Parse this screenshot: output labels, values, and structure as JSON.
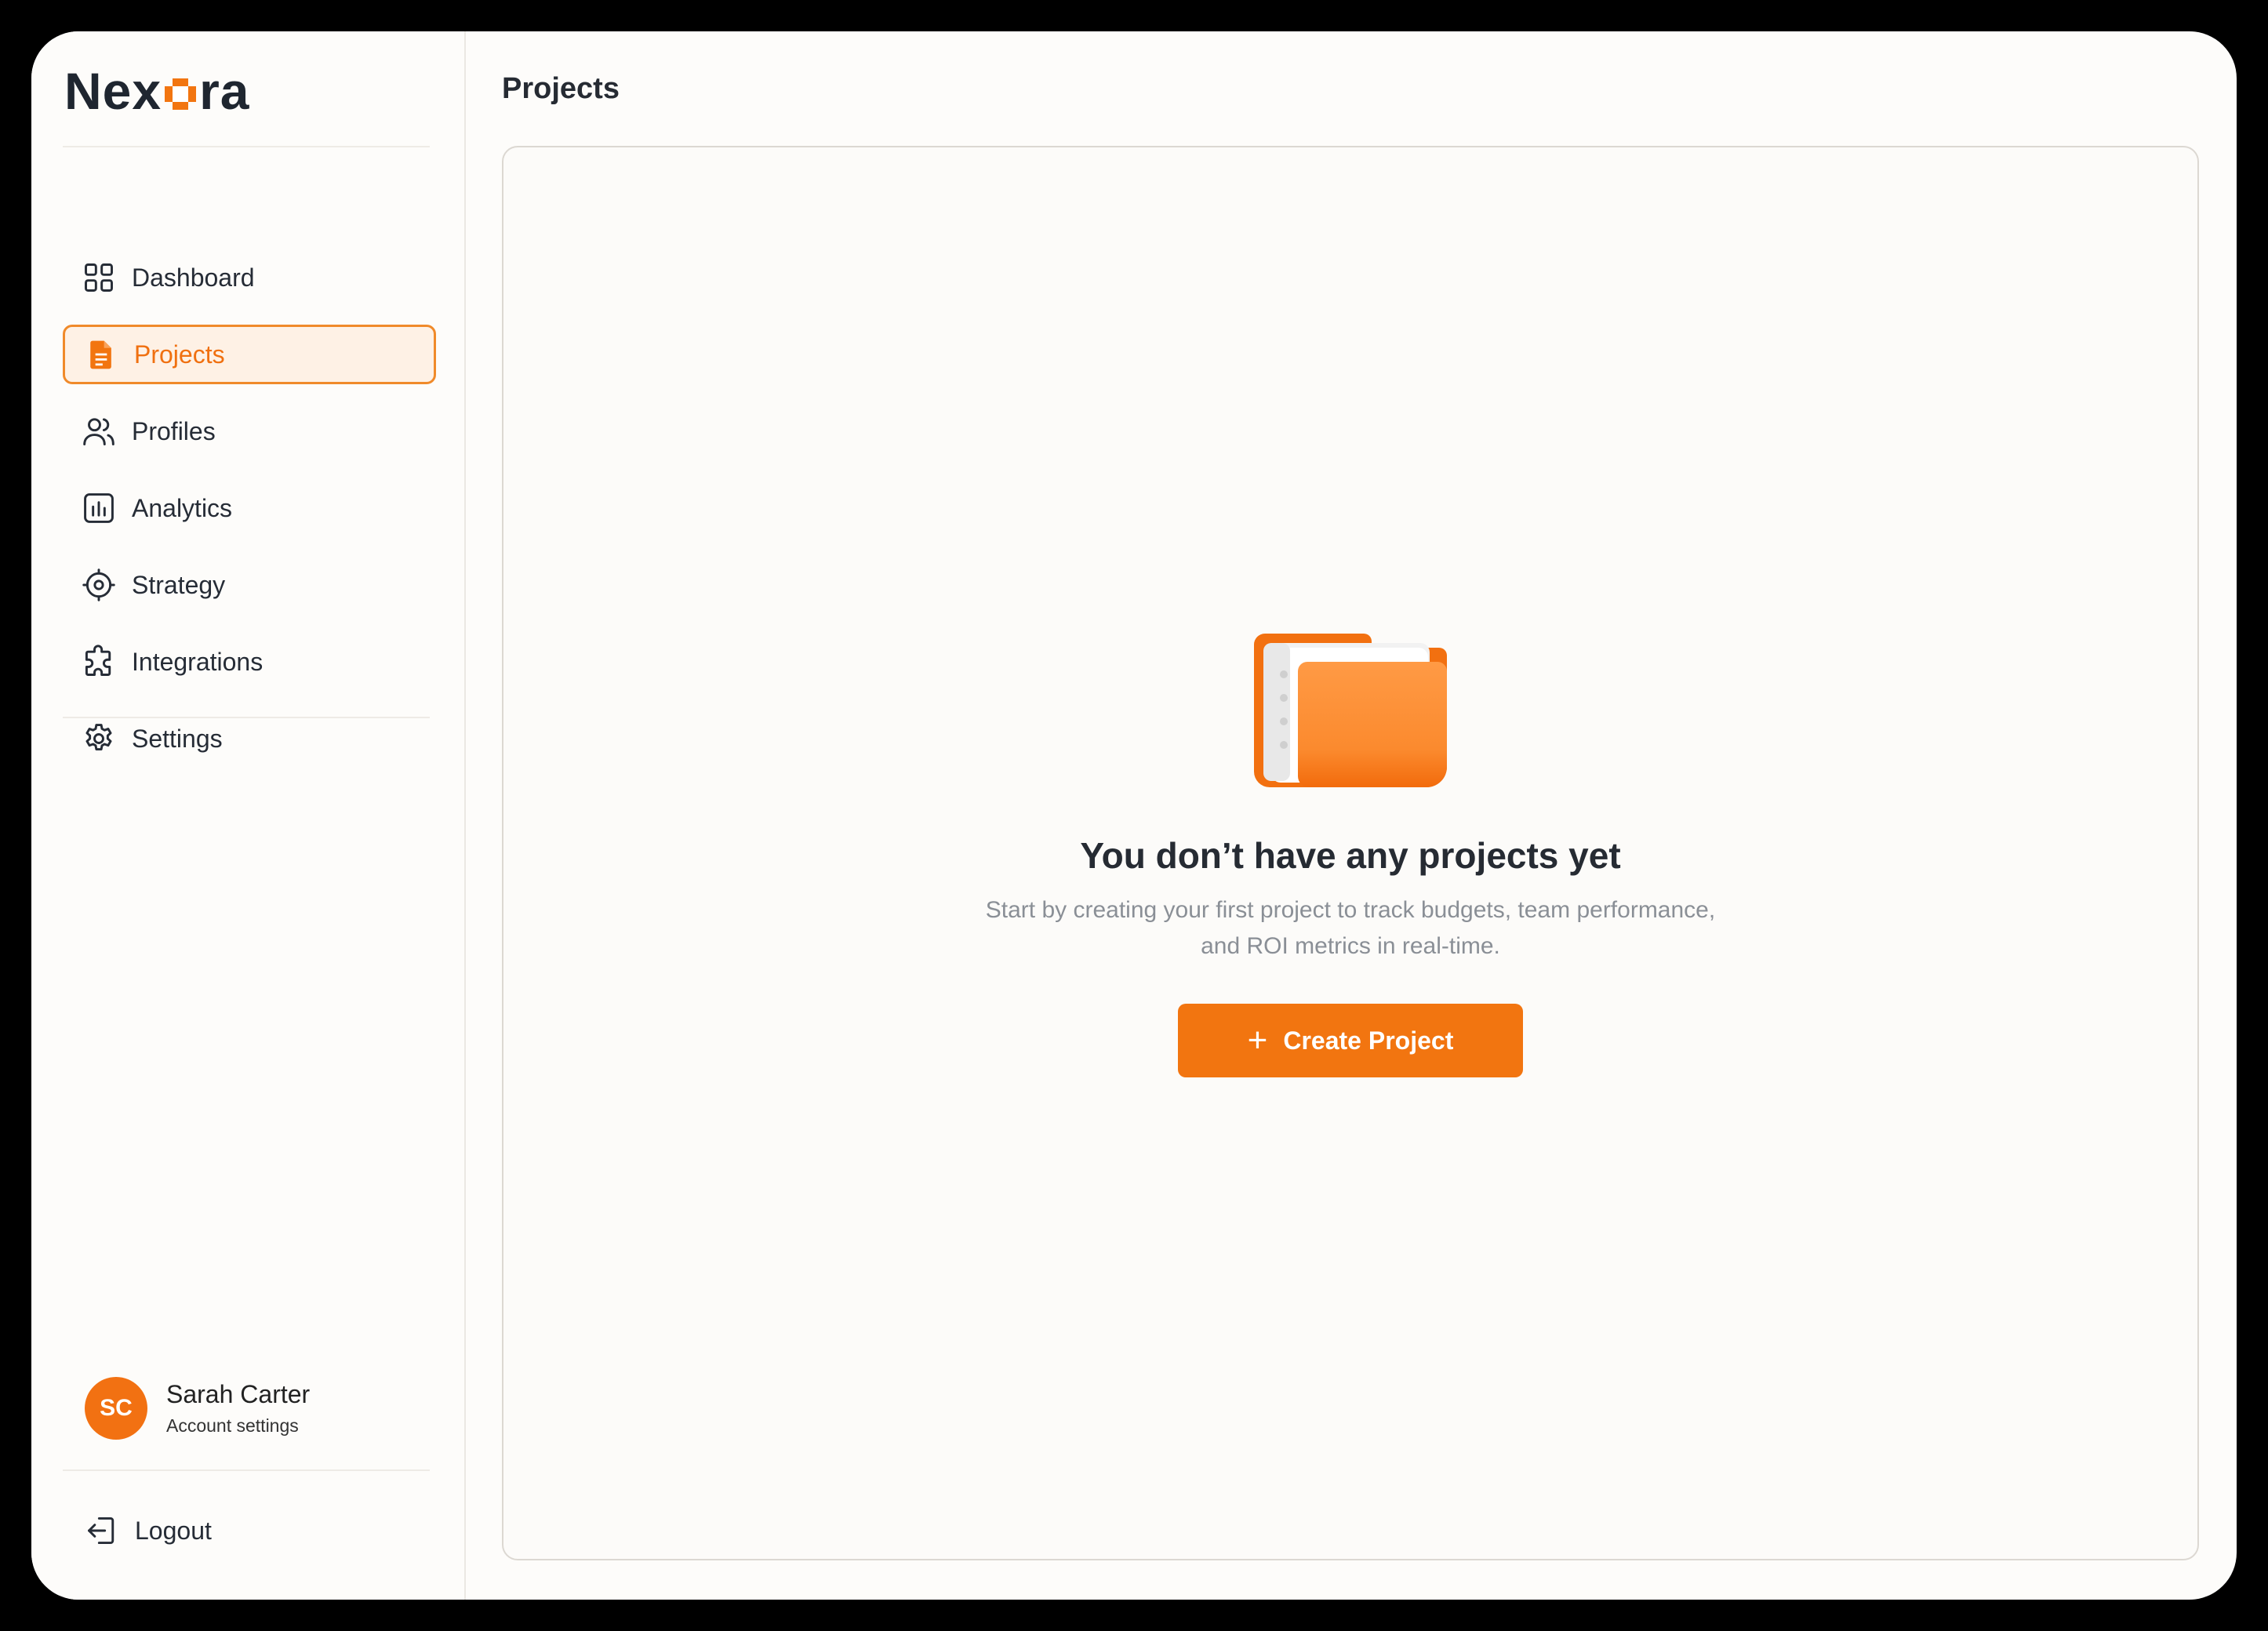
{
  "brand": {
    "name_prefix": "Nex",
    "name_suffix": "ra",
    "accent": "#f27510"
  },
  "sidebar": {
    "items": [
      {
        "label": "Dashboard",
        "icon": "grid-icon",
        "active": false
      },
      {
        "label": "Projects",
        "icon": "document-icon",
        "active": true
      },
      {
        "label": "Profiles",
        "icon": "users-icon",
        "active": false
      },
      {
        "label": "Analytics",
        "icon": "chart-icon",
        "active": false
      },
      {
        "label": "Strategy",
        "icon": "target-icon",
        "active": false
      },
      {
        "label": "Integrations",
        "icon": "puzzle-icon",
        "active": false
      },
      {
        "label": "Settings",
        "icon": "gear-icon",
        "active": false
      }
    ],
    "user": {
      "initials": "SC",
      "name": "Sarah Carter",
      "subtitle": "Account settings"
    },
    "logout_label": "Logout"
  },
  "main": {
    "title": "Projects",
    "empty_state": {
      "title": "You don’t have any projects yet",
      "description_line1": "Start by creating your first project to track budgets, team performance,",
      "description_line2": "and ROI metrics in real-time.",
      "button_label": "Create Project"
    }
  }
}
